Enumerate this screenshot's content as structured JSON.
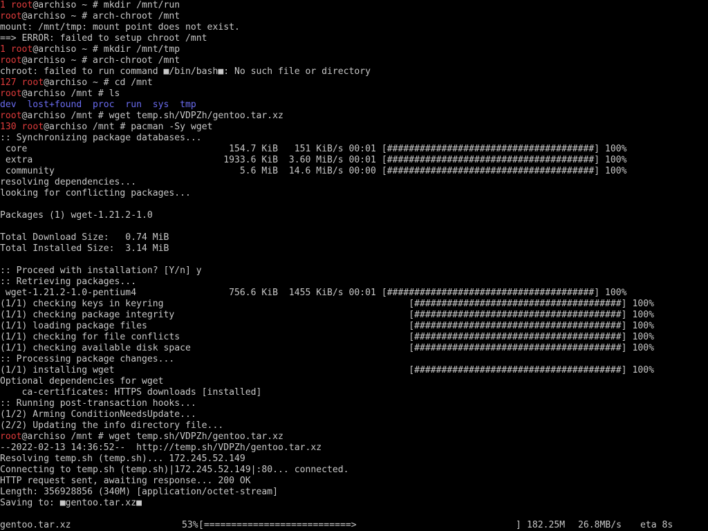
{
  "terminal": {
    "lines": [
      {
        "parts": [
          {
            "t": "1 ",
            "c": "red"
          },
          {
            "t": "root",
            "c": "red"
          },
          {
            "t": "@archiso ~ # mkdir /mnt/run"
          }
        ]
      },
      {
        "parts": [
          {
            "t": "root",
            "c": "red"
          },
          {
            "t": "@archiso ~ # arch-chroot /mnt"
          }
        ]
      },
      {
        "parts": [
          {
            "t": "mount: /mnt/tmp: mount point does not exist."
          }
        ]
      },
      {
        "parts": [
          {
            "t": "==> ERROR: failed to setup chroot /mnt"
          }
        ]
      },
      {
        "parts": [
          {
            "t": "1 ",
            "c": "red"
          },
          {
            "t": "root",
            "c": "red"
          },
          {
            "t": "@archiso ~ # mkdir /mnt/tmp"
          }
        ]
      },
      {
        "parts": [
          {
            "t": "root",
            "c": "red"
          },
          {
            "t": "@archiso ~ # arch-chroot /mnt"
          }
        ]
      },
      {
        "parts": [
          {
            "t": "chroot: failed to run command ■/bin/bash■: No such file or directory"
          }
        ]
      },
      {
        "parts": [
          {
            "t": "127 ",
            "c": "red"
          },
          {
            "t": "root",
            "c": "red"
          },
          {
            "t": "@archiso ~ # cd /mnt"
          }
        ]
      },
      {
        "parts": [
          {
            "t": "root",
            "c": "red"
          },
          {
            "t": "@archiso /mnt # ls"
          }
        ]
      },
      {
        "parts": [
          {
            "t": "dev  lost+found  proc  run  sys  tmp",
            "c": "blue"
          }
        ]
      },
      {
        "parts": [
          {
            "t": "root",
            "c": "red"
          },
          {
            "t": "@archiso /mnt # wget temp.sh/VDPZh/gentoo.tar.xz"
          }
        ]
      },
      {
        "parts": [
          {
            "t": "130 ",
            "c": "red"
          },
          {
            "t": "root",
            "c": "red"
          },
          {
            "t": "@archiso /mnt # pacman -Sy wget"
          }
        ]
      },
      {
        "parts": [
          {
            "t": ":: Synchronizing package databases..."
          }
        ]
      },
      {
        "parts": [
          {
            "t": " core                                     154.7 KiB   151 KiB/s 00:01 [######################################] 100%"
          }
        ]
      },
      {
        "parts": [
          {
            "t": " extra                                   1933.6 KiB  3.60 MiB/s 00:01 [######################################] 100%"
          }
        ]
      },
      {
        "parts": [
          {
            "t": " community                                  5.6 MiB  14.6 MiB/s 00:00 [######################################] 100%"
          }
        ]
      },
      {
        "parts": [
          {
            "t": "resolving dependencies..."
          }
        ]
      },
      {
        "parts": [
          {
            "t": "looking for conflicting packages..."
          }
        ]
      },
      {
        "parts": [
          {
            "t": ""
          }
        ]
      },
      {
        "parts": [
          {
            "t": "Packages (1) wget-1.21.2-1.0"
          }
        ]
      },
      {
        "parts": [
          {
            "t": ""
          }
        ]
      },
      {
        "parts": [
          {
            "t": "Total Download Size:   0.74 MiB"
          }
        ]
      },
      {
        "parts": [
          {
            "t": "Total Installed Size:  3.14 MiB"
          }
        ]
      },
      {
        "parts": [
          {
            "t": ""
          }
        ]
      },
      {
        "parts": [
          {
            "t": ":: Proceed with installation? [Y/n] y"
          }
        ]
      },
      {
        "parts": [
          {
            "t": ":: Retrieving packages..."
          }
        ]
      },
      {
        "parts": [
          {
            "t": " wget-1.21.2-1.0-pentium4                 756.6 KiB  1455 KiB/s 00:01 [######################################] 100%"
          }
        ]
      },
      {
        "parts": [
          {
            "t": "(1/1) checking keys in keyring                                             [######################################] 100%"
          }
        ]
      },
      {
        "parts": [
          {
            "t": "(1/1) checking package integrity                                           [######################################] 100%"
          }
        ]
      },
      {
        "parts": [
          {
            "t": "(1/1) loading package files                                                [######################################] 100%"
          }
        ]
      },
      {
        "parts": [
          {
            "t": "(1/1) checking for file conflicts                                          [######################################] 100%"
          }
        ]
      },
      {
        "parts": [
          {
            "t": "(1/1) checking available disk space                                        [######################################] 100%"
          }
        ]
      },
      {
        "parts": [
          {
            "t": ":: Processing package changes..."
          }
        ]
      },
      {
        "parts": [
          {
            "t": "(1/1) installing wget                                                      [######################################] 100%"
          }
        ]
      },
      {
        "parts": [
          {
            "t": "Optional dependencies for wget"
          }
        ]
      },
      {
        "parts": [
          {
            "t": "    ca-certificates: HTTPS downloads [installed]"
          }
        ]
      },
      {
        "parts": [
          {
            "t": ":: Running post-transaction hooks..."
          }
        ]
      },
      {
        "parts": [
          {
            "t": "(1/2) Arming ConditionNeedsUpdate..."
          }
        ]
      },
      {
        "parts": [
          {
            "t": "(2/2) Updating the info directory file..."
          }
        ]
      },
      {
        "parts": [
          {
            "t": "root",
            "c": "red"
          },
          {
            "t": "@archiso /mnt # wget temp.sh/VDPZh/gentoo.tar.xz"
          }
        ]
      },
      {
        "parts": [
          {
            "t": "--2022-02-13 14:36:52--  http://temp.sh/VDPZh/gentoo.tar.xz"
          }
        ]
      },
      {
        "parts": [
          {
            "t": "Resolving temp.sh (temp.sh)... 172.245.52.149"
          }
        ]
      },
      {
        "parts": [
          {
            "t": "Connecting to temp.sh (temp.sh)|172.245.52.149|:80... connected."
          }
        ]
      },
      {
        "parts": [
          {
            "t": "HTTP request sent, awaiting response... 200 OK"
          }
        ]
      },
      {
        "parts": [
          {
            "t": "Length: 356928856 (340M) [application/octet-stream]"
          }
        ]
      },
      {
        "parts": [
          {
            "t": "Saving to: ■gentoo.tar.xz■"
          }
        ]
      },
      {
        "parts": [
          {
            "t": ""
          }
        ]
      }
    ],
    "status": {
      "file": "gentoo.tar.xz",
      "percent": "53%",
      "bar": "[===========================>",
      "bar_end": "]",
      "size": "182.25M",
      "rate": "26.8MB/s",
      "eta": "eta 8s"
    }
  },
  "colors": {
    "background": "#000000",
    "text": "#c8c8c8",
    "prompt_red": "#e03c3c",
    "dir_blue": "#6a6cf0"
  }
}
